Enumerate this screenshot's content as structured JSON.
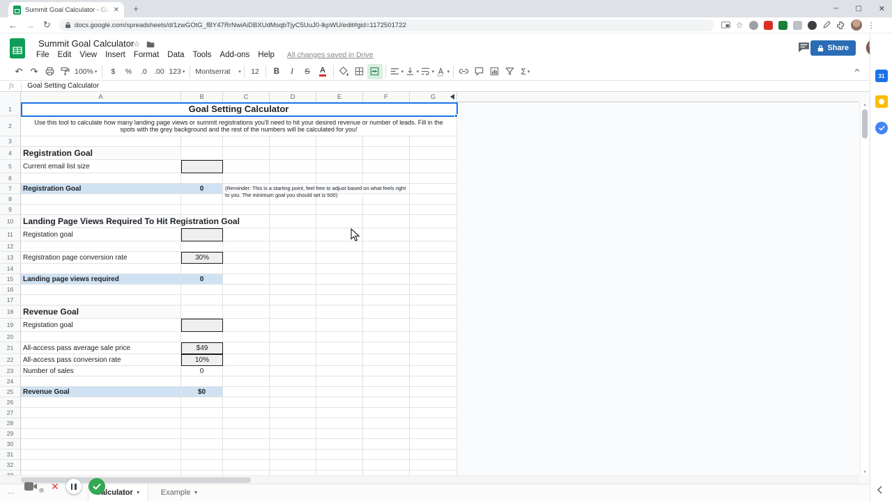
{
  "browser": {
    "tab_title": "Summit Goal Calculator - Googl",
    "new_tab": "+",
    "url": "docs.google.com/spreadsheets/d/1zwGOtG_fBY47RrNwiAiDBXUdMsqbTjyC5UuJ0-lkpWU/edit#gid=1172501722"
  },
  "header": {
    "doc_title": "Summit Goal Calculator",
    "menus": [
      "File",
      "Edit",
      "View",
      "Insert",
      "Format",
      "Data",
      "Tools",
      "Add-ons",
      "Help"
    ],
    "saved_status": "All changes saved in Drive",
    "share_label": "Share"
  },
  "toolbar": {
    "zoom": "100%",
    "currency": "$",
    "percent": "%",
    "decrease_decimal": ".0",
    "increase_decimal": ".00",
    "more_formats": "123",
    "font": "Montserrat",
    "font_size": "12",
    "bold": "B",
    "italic": "I",
    "strikethrough": "S",
    "text_color": "A",
    "functions": "Σ",
    "icons": [
      "undo-icon",
      "redo-icon",
      "print-icon",
      "paint-format-icon",
      "fill-color-icon",
      "borders-icon",
      "merge-cells-icon",
      "horizontal-align-icon",
      "vertical-align-icon",
      "text-wrap-icon",
      "text-rotation-icon",
      "insert-link-icon",
      "insert-comment-icon",
      "insert-chart-icon",
      "filter-icon",
      "functions-icon",
      "collapse-toolbar-icon"
    ]
  },
  "formula_bar": {
    "fx_label": "fx",
    "value": "Goal Setting Calculator"
  },
  "grid": {
    "columns": [
      "A",
      "B",
      "C",
      "D",
      "E",
      "F",
      "G"
    ],
    "row_count": 33,
    "rows": [
      {
        "n": 1,
        "h": 20,
        "cells": [
          {
            "c": 0,
            "span": 7,
            "t": "Goal Setting Calculator",
            "s": "title"
          }
        ]
      },
      {
        "n": 2,
        "h": 29,
        "cells": [
          {
            "c": 0,
            "span": 7,
            "t": "Use this tool to calculate how many landing page views or summit registrations you'll need to hit your desired revenue or number of leads. Fill in the spots with the grey background and the rest of the numbers will be calculated for you!",
            "s": "desc"
          }
        ]
      },
      {
        "n": 4,
        "h": 19,
        "cells": [
          {
            "c": 0,
            "t": "Registration Goal",
            "s": "section"
          }
        ]
      },
      {
        "n": 5,
        "h": 19,
        "cells": [
          {
            "c": 0,
            "t": "Current email list size",
            "s": "label"
          },
          {
            "c": 1,
            "t": "",
            "s": "input"
          }
        ]
      },
      {
        "n": 7,
        "cells": [
          {
            "c": 0,
            "t": "Registration Goal",
            "s": "hlabel"
          },
          {
            "c": 1,
            "t": "0",
            "s": "hvalue"
          },
          {
            "c": 2,
            "span": 4,
            "t": "(Reminder: This is a starting point, feel free to adjust based on what feels right to you. The minimum goal you should set is 500)",
            "s": "note"
          }
        ]
      },
      {
        "n": 10,
        "h": 19,
        "cells": [
          {
            "c": 0,
            "t": "Landing Page Views Required To Hit Registration Goal",
            "s": "section"
          }
        ]
      },
      {
        "n": 11,
        "h": 19,
        "cells": [
          {
            "c": 0,
            "t": "Registation goal",
            "s": "label"
          },
          {
            "c": 1,
            "t": "",
            "s": "input"
          }
        ]
      },
      {
        "n": 13,
        "h": 17,
        "cells": [
          {
            "c": 0,
            "t": "Registration page conversion rate",
            "s": "label"
          },
          {
            "c": 1,
            "t": "30%",
            "s": "input"
          }
        ]
      },
      {
        "n": 15,
        "cells": [
          {
            "c": 0,
            "t": "Landing page views required",
            "s": "hlabel"
          },
          {
            "c": 1,
            "t": "0",
            "s": "hvalue"
          }
        ]
      },
      {
        "n": 18,
        "h": 19,
        "cells": [
          {
            "c": 0,
            "t": "Revenue Goal",
            "s": "section"
          }
        ]
      },
      {
        "n": 19,
        "h": 19,
        "cells": [
          {
            "c": 0,
            "t": "Registation goal",
            "s": "label"
          },
          {
            "c": 1,
            "t": "",
            "s": "input"
          }
        ]
      },
      {
        "n": 21,
        "h": 17,
        "cells": [
          {
            "c": 0,
            "t": "All-access pass average sale price",
            "s": "label"
          },
          {
            "c": 1,
            "t": "$49",
            "s": "input"
          }
        ]
      },
      {
        "n": 22,
        "h": 17,
        "cells": [
          {
            "c": 0,
            "t": "All-access pass conversion rate",
            "s": "label"
          },
          {
            "c": 1,
            "t": "10%",
            "s": "input"
          }
        ]
      },
      {
        "n": 23,
        "cells": [
          {
            "c": 0,
            "t": "Number of sales",
            "s": "label"
          },
          {
            "c": 1,
            "t": "0",
            "s": "value"
          }
        ]
      },
      {
        "n": 25,
        "cells": [
          {
            "c": 0,
            "t": "Revenue Goal",
            "s": "hlabel"
          },
          {
            "c": 1,
            "t": "$0",
            "s": "hvalue"
          }
        ]
      }
    ]
  },
  "sheet_tabs": [
    {
      "label": "Calculator"
    },
    {
      "label": "Example"
    }
  ],
  "recorder": {
    "icons": [
      "camera-icon",
      "stop-icon",
      "pause-icon",
      "done-icon"
    ]
  },
  "side_panel": {
    "calendar_label": "31",
    "icons": [
      "calendar-icon",
      "keep-icon",
      "tasks-icon",
      "collapse-panel-icon"
    ]
  },
  "colors": {
    "accent_blue": "#1a73e8",
    "highlight_blue": "#cfe2f3",
    "input_grey": "#efefef",
    "share_button": "#2a6db4",
    "sheets_green": "#0f9d58",
    "record_green": "#34a853",
    "record_red": "#e53935"
  }
}
